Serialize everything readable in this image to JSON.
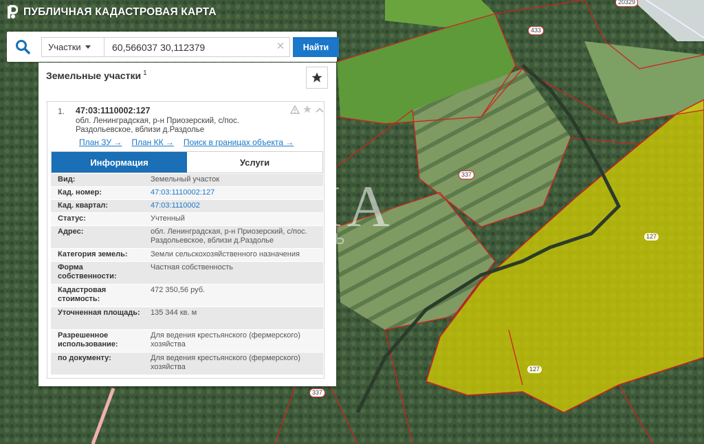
{
  "brand": {
    "title": "ПУБЛИЧНАЯ КАДАСТРОВАЯ КАРТА"
  },
  "search": {
    "type_label": "Участки",
    "query": "60,566037 30,112379",
    "find_label": "Найти"
  },
  "panel": {
    "title": "Земельные участки",
    "count": "1"
  },
  "result": {
    "index": "1.",
    "cad_number": "47:03:1110002:127",
    "address_line1": "обл. Ленинградская, р-н Приозерский, с/пос.",
    "address_line2": "Раздольевское, вблизи д.Раздолье",
    "links": [
      "План ЗУ →",
      "План КК →",
      "Поиск в границах объекта →"
    ],
    "tabs": {
      "info": "Информация",
      "services": "Услуги"
    },
    "fields": [
      {
        "k": "Вид:",
        "v": "Земельный участок"
      },
      {
        "k": "Кад. номер:",
        "v": "47:03:1110002:127"
      },
      {
        "k": "Кад. квартал:",
        "v": "47:03:1110002"
      },
      {
        "k": "Статус:",
        "v": "Учтенный"
      },
      {
        "k": "Адрес:",
        "v": "обл. Ленинградская, р-н Приозерский, с/пос. Раздольевское, вблизи д.Раздолье"
      },
      {
        "k": "Категория земель:",
        "v": "Земли сельскохозяйственного назначения"
      },
      {
        "k": "Форма собственности:",
        "v": "Частная собственность"
      },
      {
        "k": "Кадастровая стоимость:",
        "v": "472 350,56 руб."
      },
      {
        "k": "Уточненная площадь:",
        "v": "135 344 кв. м"
      },
      {
        "k": "Разрешенное использование:",
        "v": "Для ведения крестьянского (фермерского) хозяйства"
      },
      {
        "k": "по документу:",
        "v": "Для ведения крестьянского (фермерского) хозяйства"
      }
    ]
  },
  "map": {
    "labels": [
      "433",
      "337",
      "337",
      "127",
      "127",
      "20329"
    ]
  },
  "watermark": {
    "main": "ИТАКА",
    "sub": "НЕДВИЖИМОСТЬ"
  },
  "colors": {
    "accent": "#1a77c9",
    "tab_active": "#1a6fb6",
    "parcel_fill": "#d6d000",
    "parcel_border": "#d02020"
  }
}
